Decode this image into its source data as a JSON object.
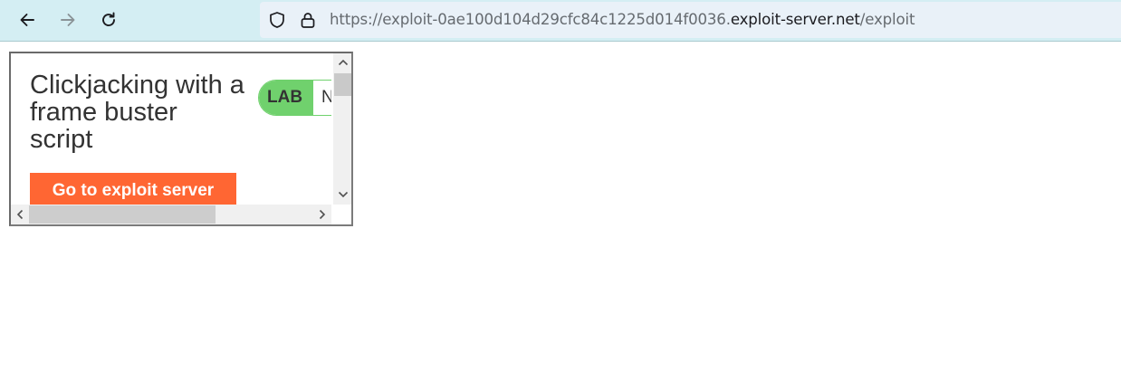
{
  "browser": {
    "url_prefix": "https://exploit-0ae100d104d29cfc84c1225d014f0036.",
    "url_host": "exploit-server.net",
    "url_path": "/exploit"
  },
  "frame": {
    "title": "Clickjacking with a frame buster script",
    "badge_label": "LAB",
    "badge_status": "N",
    "button_label": "Go to exploit server"
  },
  "colors": {
    "toolbar_bg": "#d4eef3",
    "addressbar_bg": "#e9f1f8",
    "badge_green": "#70d16d",
    "button_orange": "#ff6633"
  }
}
